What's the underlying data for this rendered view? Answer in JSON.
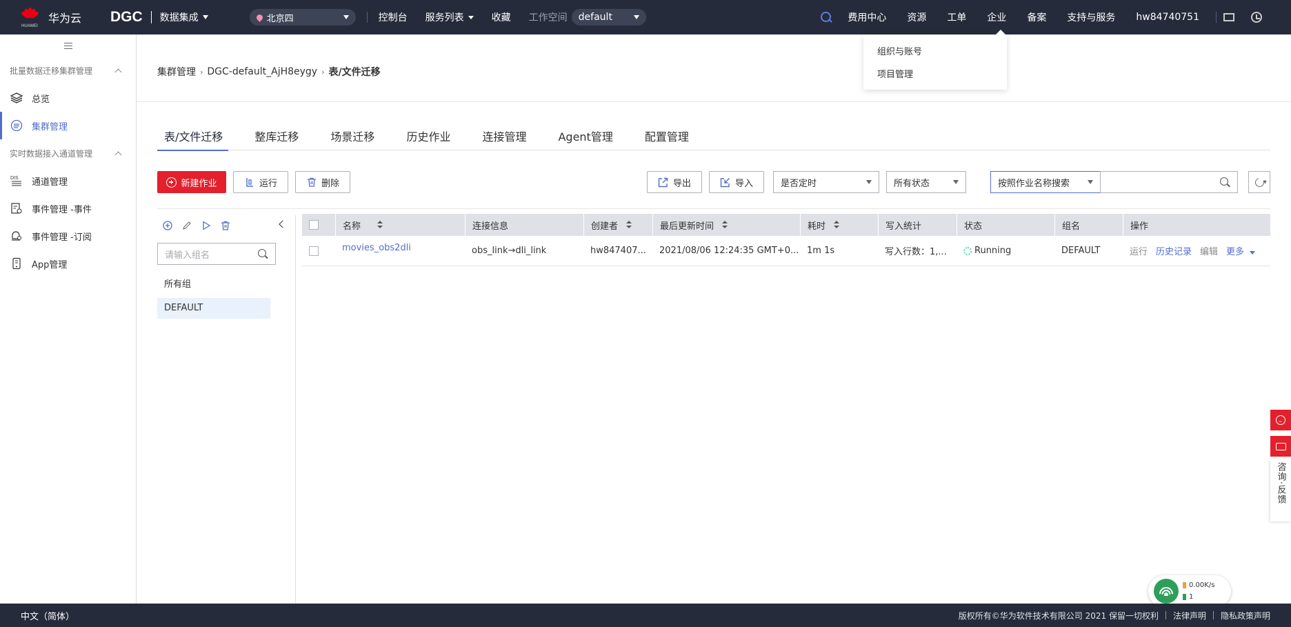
{
  "topbar": {
    "brand": "华为云",
    "brand_sub": "HUAWEI",
    "product_logo": "DGC",
    "product_name": "数据集成",
    "region": "北京四",
    "nav": [
      "控制台",
      "服务列表",
      "收藏"
    ],
    "workspace_label": "工作空间",
    "workspace_value": "default",
    "right_links": [
      "费用中心",
      "资源",
      "工单",
      "企业",
      "备案",
      "支持与服务"
    ],
    "username": "hw84740751"
  },
  "dropdown": {
    "items": [
      "组织与账号",
      "项目管理"
    ]
  },
  "sidebar": {
    "groups": [
      {
        "title": "批量数据迁移集群管理",
        "items": [
          {
            "label": "总览",
            "icon": "layers-icon"
          },
          {
            "label": "集群管理",
            "icon": "cluster-icon",
            "active": true
          }
        ]
      },
      {
        "title": "实时数据接入通道管理",
        "items": [
          {
            "label": "通道管理",
            "icon": "dis-icon"
          },
          {
            "label": "事件管理 -事件",
            "icon": "event-icon"
          },
          {
            "label": "事件管理 -订阅",
            "icon": "subscribe-icon"
          },
          {
            "label": "App管理",
            "icon": "app-icon"
          }
        ]
      }
    ]
  },
  "breadcrumb": {
    "items": [
      "集群管理",
      "DGC-default_AjH8eygy"
    ],
    "current": "表/文件迁移"
  },
  "tabs": [
    "表/文件迁移",
    "整库迁移",
    "场景迁移",
    "历史作业",
    "连接管理",
    "Agent管理",
    "配置管理"
  ],
  "toolbar": {
    "new_job": "新建作业",
    "run": "运行",
    "delete": "删除",
    "export": "导出",
    "import": "导入",
    "filter_timed": "是否定时",
    "filter_status": "所有状态",
    "search_by": "按照作业名称搜索",
    "search_value": ""
  },
  "group_panel": {
    "search_placeholder": "请输入组名",
    "items": [
      "所有组",
      "DEFAULT"
    ]
  },
  "table": {
    "columns": [
      "名称",
      "连接信息",
      "创建者",
      "最后更新时间",
      "耗时",
      "写入统计",
      "状态",
      "组名",
      "操作"
    ],
    "rows": [
      {
        "name": "movies_obs2dli",
        "connection": "obs_link→dli_link",
        "creator": "hw847407...",
        "updated": "2021/08/06 12:24:35 GMT+0...",
        "duration": "1m 1s",
        "write_stats": "写入行数：1,...",
        "status": "Running",
        "group": "DEFAULT",
        "actions": {
          "run": "运行",
          "history": "历史记录",
          "edit": "编辑",
          "more": "更多"
        }
      }
    ]
  },
  "feedback": {
    "label": "咨询·反馈"
  },
  "network_widget": {
    "speed": "0.00K/s",
    "count": "1"
  },
  "footer": {
    "language": "中文（简体）",
    "copyright": "版权所有©华为软件技术有限公司 2021 保留一切权利",
    "legal": "法律声明",
    "privacy": "隐私政策声明"
  },
  "colors": {
    "topbar_bg": "#252b3a",
    "accent_blue": "#526ecc",
    "primary_red": "#e3202c",
    "running_green": "#50d4ab"
  }
}
